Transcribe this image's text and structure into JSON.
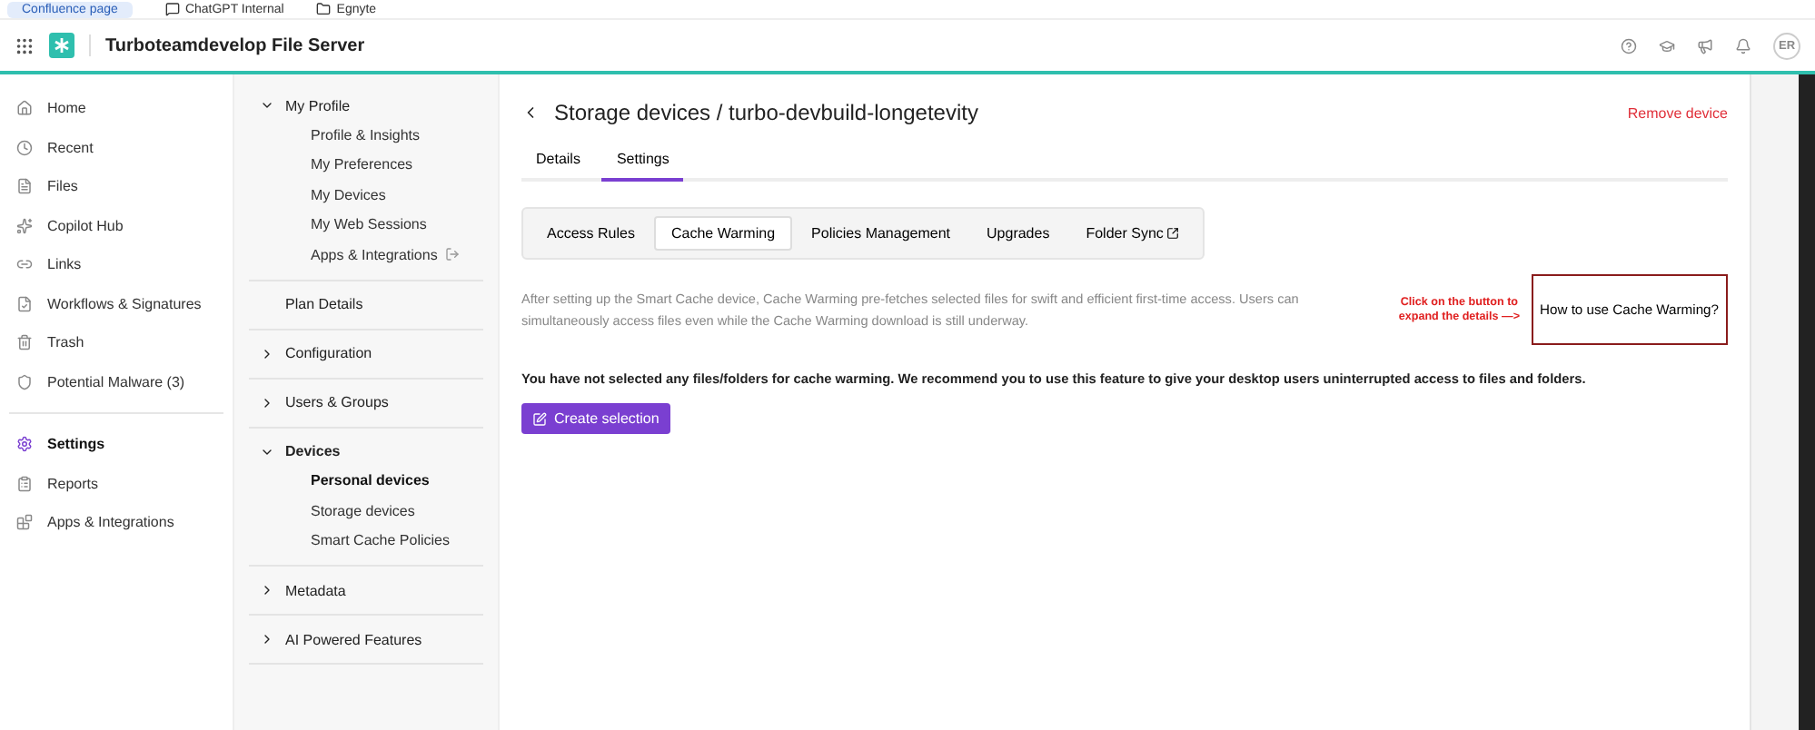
{
  "bookmarks": [
    {
      "label": "Confluence page",
      "kind": "badge"
    },
    {
      "label": "ChatGPT Internal",
      "kind": "chat"
    },
    {
      "label": "Egnyte",
      "kind": "folder"
    }
  ],
  "header": {
    "title": "Turboteamdevelop File Server",
    "avatar": "ER"
  },
  "nav_groups": [
    {
      "items": [
        {
          "label": "Home",
          "selected": false
        },
        {
          "label": "Recent",
          "selected": false
        },
        {
          "label": "Files",
          "selected": false
        },
        {
          "label": "Copilot Hub",
          "selected": false
        },
        {
          "label": "Links",
          "selected": false
        },
        {
          "label": "Workflows & Signatures",
          "selected": false
        },
        {
          "label": "Trash",
          "selected": false
        },
        {
          "label": "Potential Malware (3)",
          "selected": false
        }
      ]
    },
    {
      "items": [
        {
          "label": "Settings",
          "selected": true
        },
        {
          "label": "Reports",
          "selected": false
        },
        {
          "label": "Apps & Integrations",
          "selected": false
        }
      ]
    }
  ],
  "settings_menu": [
    {
      "label": "My Profile",
      "kind": "section",
      "expanded": true,
      "children": [
        {
          "label": "Profile & Insights",
          "selected": false,
          "external": false
        },
        {
          "label": "My Preferences",
          "selected": false,
          "external": false
        },
        {
          "label": "My Devices",
          "selected": false,
          "external": false
        },
        {
          "label": "My Web Sessions",
          "selected": false,
          "external": false
        },
        {
          "label": "Apps & Integrations",
          "selected": false,
          "external": true
        }
      ]
    },
    {
      "label": "Plan Details",
      "kind": "link",
      "expanded": false
    },
    {
      "label": "Configuration",
      "kind": "section",
      "expanded": false
    },
    {
      "label": "Users & Groups",
      "kind": "section",
      "expanded": false
    },
    {
      "label": "Devices",
      "kind": "section",
      "expanded": true,
      "children": [
        {
          "label": "Personal devices",
          "selected": true,
          "external": false
        },
        {
          "label": "Storage devices",
          "selected": false,
          "external": false
        },
        {
          "label": "Smart Cache Policies",
          "selected": false,
          "external": false
        }
      ]
    },
    {
      "label": "Metadata",
      "kind": "section",
      "expanded": false
    },
    {
      "label": "AI Powered Features",
      "kind": "section",
      "expanded": false
    }
  ],
  "page": {
    "title": "Storage devices / turbo-devbuild-longetevity",
    "remove_button": "Remove device",
    "tabs": [
      {
        "label": "Details",
        "selected": false
      },
      {
        "label": "Settings",
        "selected": true
      }
    ],
    "subtabs": [
      {
        "label": "Access Rules",
        "selected": false,
        "external": false
      },
      {
        "label": "Cache Warming",
        "selected": true,
        "external": false
      },
      {
        "label": "Policies Management",
        "selected": false,
        "external": false
      },
      {
        "label": "Upgrades",
        "selected": false,
        "external": false
      },
      {
        "label": "Folder Sync",
        "selected": false,
        "external": true
      }
    ],
    "description": "After setting up the Smart Cache device, Cache Warming pre-fetches selected files for swift and efficient first-time access. Users can simultaneously access files even while the Cache Warming download is still underway.",
    "annotation": [
      "Click on the button to",
      "expand the details —>"
    ],
    "help_button": "How to use Cache Warming?",
    "notice": "You have not selected any files/folders for cache warming. We recommend you to use this feature to give your desktop users uninterrupted access to files and folders.",
    "create_button": "Create selection"
  }
}
